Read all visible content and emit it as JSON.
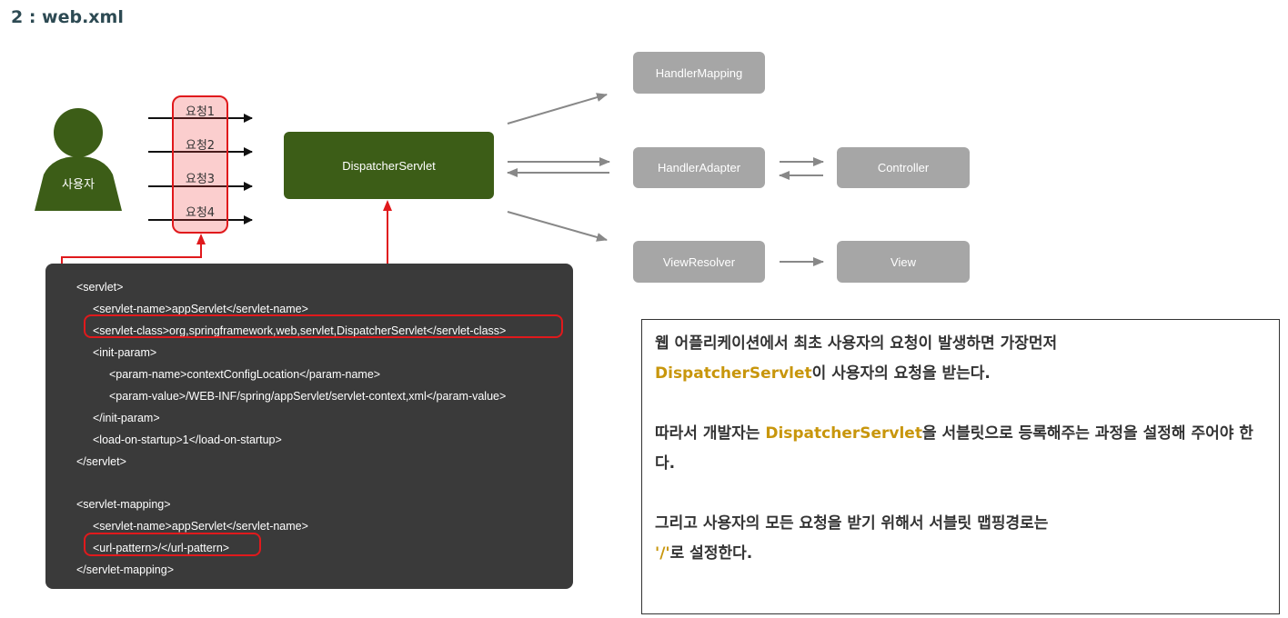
{
  "heading": "2 : web.xml",
  "user": {
    "label": "사용자"
  },
  "requests": [
    "요청1",
    "요청2",
    "요청3",
    "요청4"
  ],
  "dispatcher": "DispatcherServlet",
  "components": {
    "handler_mapping": "HandlerMapping",
    "handler_adapter": "HandlerAdapter",
    "controller": "Controller",
    "view_resolver": "ViewResolver",
    "view": "View"
  },
  "code_lines": [
    "<servlet>",
    "<servlet-name>appServlet</servlet-name>",
    "<servlet-class>org,springframework,web,servlet,DispatcherServlet</servlet-class>",
    "<init-param>",
    "<param-name>contextConfigLocation</param-name>",
    "<param-value>/WEB-INF/spring/appServlet/servlet-context,xml</param-value>",
    "</init-param>",
    "<load-on-startup>1</load-on-startup>",
    "</servlet>",
    "<servlet-mapping>",
    "<servlet-name>appServlet</servlet-name>",
    "<url-pattern>/</url-pattern>",
    "</servlet-mapping>"
  ],
  "note": {
    "p1_before": "웹 어플리케이션에서 최초 사용자의 요청이 발생하면 가장먼저",
    "p1_accent": "DispatcherServlet",
    "p1_after": "이 사용자의 요청을 받는다.",
    "p2_before": "따라서 개발자는 ",
    "p2_accent": "DispatcherServlet",
    "p2_after": "을 서블릿으로 등록해주는 과정을 설정해 주어야 한다.",
    "p3_text": "그리고 사용자의 모든 요청을 받기 위해서 서블릿 맵핑경로는",
    "p3_accent": "'/'",
    "p3_after": "로 설정한다."
  },
  "colors": {
    "dispatcher": "#3c5d17",
    "user": "#3c5d17",
    "component": "#a6a6a6",
    "highlight": "#e0191c",
    "accent": "#c8960c",
    "code_bg": "#3a3a3a"
  }
}
